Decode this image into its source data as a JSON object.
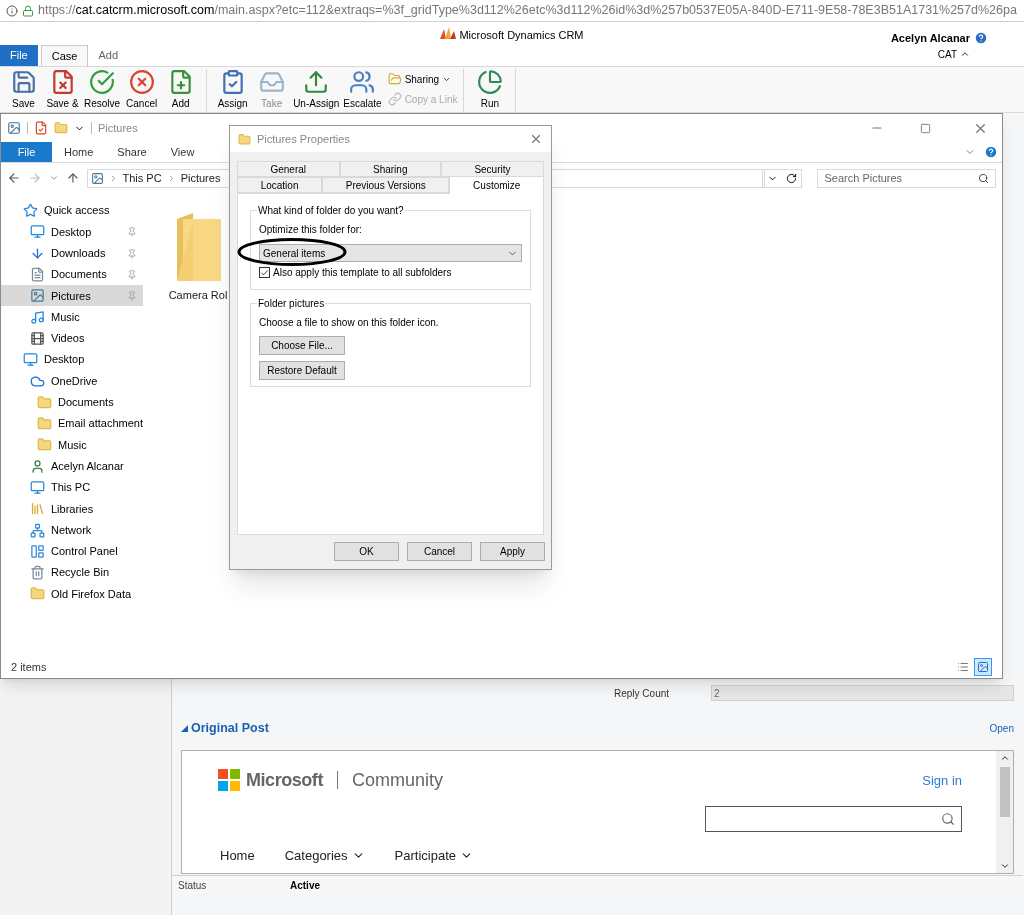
{
  "browser": {
    "url_scheme": "https://",
    "url_host": "cat.catcrm.microsoft.com",
    "url_path": "/main.aspx?etc=112&extraqs=%3f_gridType%3d112%26etc%3d112%26id%3d%257b0537E05A-840D-E711-9E58-78E3B51A1731%257d%26pa"
  },
  "crm": {
    "app_title": "Microsoft Dynamics CRM",
    "user": {
      "name": "Acelyn Alcanar",
      "org": "CAT"
    },
    "tabs": [
      {
        "label": "File",
        "kind": "file",
        "selected": false
      },
      {
        "label": "Case",
        "kind": "tab",
        "selected": true
      },
      {
        "label": "Add",
        "kind": "tab",
        "selected": false
      }
    ],
    "ribbon_groups": [
      {
        "buttons": [
          {
            "label": "Save",
            "kind": "large",
            "disabled": false
          },
          {
            "label": "Save &",
            "kind": "large",
            "disabled": false
          },
          {
            "label": "Resolve",
            "kind": "large",
            "disabled": false
          },
          {
            "label": "Cancel",
            "kind": "large",
            "disabled": false
          },
          {
            "label": "Add",
            "kind": "large",
            "disabled": false
          }
        ]
      },
      {
        "buttons": [
          {
            "label": "Assign",
            "kind": "large",
            "disabled": false
          },
          {
            "label": "Take",
            "kind": "large",
            "disabled": true
          },
          {
            "label": "Un-Assign",
            "kind": "large",
            "disabled": false
          },
          {
            "label": "Escalate",
            "kind": "large",
            "disabled": false
          },
          {
            "label": "Sharing",
            "kind": "small",
            "menu": true,
            "disabled": false
          },
          {
            "label": "Copy a Link",
            "kind": "small",
            "menu": false,
            "disabled": true
          }
        ]
      },
      {
        "buttons": [
          {
            "label": "Run",
            "kind": "large",
            "disabled": false
          }
        ]
      }
    ],
    "reply_count": {
      "label": "Reply Count",
      "value": "2"
    },
    "section": {
      "title": "Original Post",
      "expanded": true,
      "action": "Open"
    },
    "community": {
      "brand": "Microsoft",
      "product": "Community",
      "sign_in": "Sign in",
      "nav": [
        {
          "label": "Home",
          "menu": false
        },
        {
          "label": "Categories",
          "menu": true
        },
        {
          "label": "Participate",
          "menu": true
        }
      ]
    },
    "status": {
      "label": "Status",
      "value": "Active"
    }
  },
  "explorer": {
    "title": "Pictures",
    "ribbon_tabs": [
      {
        "label": "File",
        "kind": "file"
      },
      {
        "label": "Home",
        "kind": "tab"
      },
      {
        "label": "Share",
        "kind": "tab"
      },
      {
        "label": "View",
        "kind": "tab"
      }
    ],
    "breadcrumb": [
      "This PC",
      "Pictures"
    ],
    "search": {
      "placeholder": "Search Pictures"
    },
    "nav": [
      {
        "label": "Quick access",
        "kind": "star",
        "selected": false,
        "pinned": false,
        "children": [
          {
            "label": "Desktop",
            "kind": "desktop",
            "selected": false,
            "pinned": true
          },
          {
            "label": "Downloads",
            "kind": "download",
            "selected": false,
            "pinned": true
          },
          {
            "label": "Documents",
            "kind": "document",
            "selected": false,
            "pinned": true
          },
          {
            "label": "Pictures",
            "kind": "picture",
            "selected": true,
            "pinned": true
          },
          {
            "label": "Music",
            "kind": "music",
            "selected": false,
            "pinned": false
          },
          {
            "label": "Videos",
            "kind": "video",
            "selected": false,
            "pinned": false
          }
        ]
      },
      {
        "label": "Desktop",
        "kind": "desktop",
        "selected": false,
        "pinned": false,
        "children": [
          {
            "label": "OneDrive",
            "kind": "cloud",
            "selected": false,
            "pinned": false,
            "children": [
              {
                "label": "Documents",
                "kind": "synced",
                "selected": false,
                "pinned": false
              },
              {
                "label": "Email attachment",
                "kind": "synced",
                "selected": false,
                "pinned": false
              },
              {
                "label": "Music",
                "kind": "synced",
                "selected": false,
                "pinned": false
              }
            ]
          },
          {
            "label": "Acelyn Alcanar",
            "kind": "user",
            "selected": false,
            "pinned": false
          },
          {
            "label": "This PC",
            "kind": "computer",
            "selected": false,
            "pinned": false
          },
          {
            "label": "Libraries",
            "kind": "library",
            "selected": false,
            "pinned": false
          },
          {
            "label": "Network",
            "kind": "network",
            "selected": false,
            "pinned": false
          },
          {
            "label": "Control Panel",
            "kind": "panel",
            "selected": false,
            "pinned": false
          },
          {
            "label": "Recycle Bin",
            "kind": "bin",
            "selected": false,
            "pinned": false
          },
          {
            "label": "Old Firefox Data",
            "kind": "folder",
            "selected": false,
            "pinned": false
          }
        ]
      }
    ],
    "items": [
      {
        "name": "Camera Rol"
      }
    ],
    "status": "2 items",
    "view_buttons": [
      {
        "kind": "details",
        "selected": false
      },
      {
        "kind": "large-icons",
        "selected": true
      }
    ]
  },
  "dialog": {
    "title": "Pictures Properties",
    "tab_rows": [
      [
        {
          "label": "General",
          "selected": false
        },
        {
          "label": "Sharing",
          "selected": false
        },
        {
          "label": "Security",
          "selected": false
        }
      ],
      [
        {
          "label": "Location",
          "selected": false
        },
        {
          "label": "Previous Versions",
          "selected": false
        },
        {
          "label": "Customize",
          "selected": true
        }
      ]
    ],
    "folder_type": {
      "title": "What kind of folder do you want?",
      "label": "Optimize this folder for:",
      "value": "General items",
      "checkbox": {
        "label": "Also apply this template to all subfolders",
        "checked": true
      }
    },
    "folder_pictures": {
      "title": "Folder pictures",
      "text": "Choose a file to show on this folder icon.",
      "buttons": [
        "Choose File...",
        "Restore Default"
      ]
    },
    "buttons": [
      "OK",
      "Cancel",
      "Apply"
    ]
  }
}
